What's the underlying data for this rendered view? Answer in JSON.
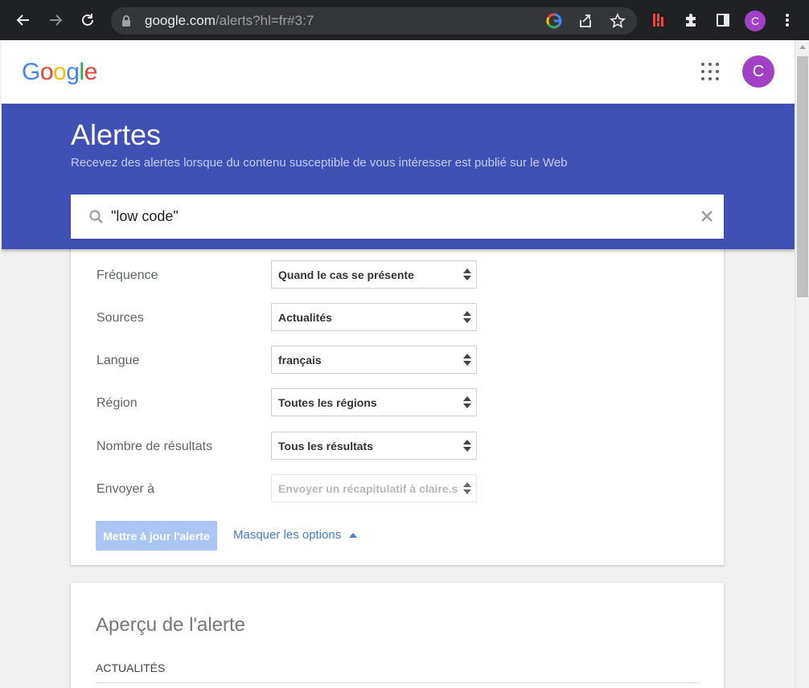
{
  "browser": {
    "url_host": "google.com",
    "url_path": "/alerts?hl=fr#3:7",
    "profile_initial": "C"
  },
  "header": {
    "logo_letters": [
      {
        "ch": "G",
        "color": "#4285f4"
      },
      {
        "ch": "o",
        "color": "#ea4335"
      },
      {
        "ch": "o",
        "color": "#fbbc05"
      },
      {
        "ch": "g",
        "color": "#4285f4"
      },
      {
        "ch": "l",
        "color": "#34a853"
      },
      {
        "ch": "e",
        "color": "#ea4335"
      }
    ],
    "avatar_initial": "C"
  },
  "banner": {
    "title": "Alertes",
    "subtitle": "Recevez des alertes lorsque du contenu susceptible de vous intéresser est publié sur le Web",
    "search_query": "\"low code\""
  },
  "options": {
    "rows": [
      {
        "label": "Fréquence",
        "value": "Quand le cas se présente"
      },
      {
        "label": "Sources",
        "value": "Actualités"
      },
      {
        "label": "Langue",
        "value": "français"
      },
      {
        "label": "Région",
        "value": "Toutes les régions"
      },
      {
        "label": "Nombre de résultats",
        "value": "Tous les résultats"
      },
      {
        "label": "Envoyer à",
        "value": "Envoyer un récapitulatif à claire.stalter"
      }
    ],
    "update_button": "Mettre à jour l'alerte",
    "hide_options": "Masquer les options"
  },
  "preview": {
    "title": "Aperçu de l'alerte",
    "section": "ACTUALITÉS"
  },
  "colors": {
    "banner": "#4051b5",
    "avatar": "#a142c6",
    "link": "#4a7bd6",
    "button_disabled": "#a9c6f5"
  }
}
